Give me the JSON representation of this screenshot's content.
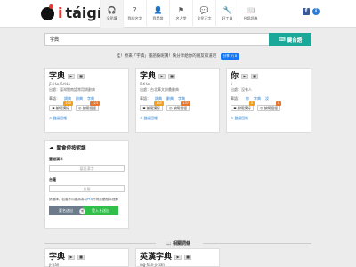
{
  "header": {
    "logo_i": "i",
    "logo_text": "táigí",
    "nav": [
      {
        "icon": "headphones-icon",
        "glyph": "🎧",
        "label": "全民講",
        "active": true
      },
      {
        "icon": "question-icon",
        "glyph": "?",
        "label": "我的名字",
        "active": false
      },
      {
        "icon": "user-icon",
        "glyph": "👤",
        "label": "我是誰",
        "active": false
      },
      {
        "icon": "flag-icon",
        "glyph": "⚑",
        "label": "名人堂",
        "active": false
      },
      {
        "icon": "chat-icon",
        "glyph": "💬",
        "label": "全民正字",
        "active": false
      },
      {
        "icon": "wrench-icon",
        "glyph": "🔧",
        "label": "好工具",
        "active": false
      },
      {
        "icon": "book-icon",
        "glyph": "📖",
        "label": "台語詞典",
        "active": false
      }
    ],
    "facebook_label": "f",
    "info_label": "i"
  },
  "search": {
    "value": "字典",
    "button_label": "鍵台語",
    "button_icon": "keyboard-icon"
  },
  "promo": {
    "text": "哇！原來「字典」臺語按呢講！快分享給你的朋友知道吧",
    "share_label": "分享 (f) 8"
  },
  "cards": [
    {
      "hanji": "字典",
      "roman": "jī-tián/lī-tián",
      "source": "出處：臺灣閩南語常用詞辭典",
      "dialect_label": "華語：",
      "dialects": [
        "詞典",
        "辭典",
        "字典"
      ],
      "vote_good": "按呢講好",
      "vote_bad": "按呢怪怪",
      "good_count": "100",
      "bad_count": "123",
      "report": "錯誤回報"
    },
    {
      "hanji": "字典",
      "roman": "lī-tián",
      "source": "出處：台北華文辭彙辭典",
      "dialect_label": "華語：",
      "dialects": [
        "詞典",
        "辭典",
        "字典"
      ],
      "vote_good": "按呢講好",
      "vote_bad": "按呢怪怪",
      "good_count": "140",
      "bad_count": "137",
      "report": "錯誤回報"
    },
    {
      "hanji": "你",
      "roman": "lí",
      "source": "出處：沒有人",
      "dialect_label": "華語：",
      "dialects": [
        "你",
        "字典",
        "汝"
      ],
      "vote_good": "按呢講好",
      "vote_bad": "按呢怪怪",
      "good_count": "0",
      "bad_count": "0",
      "report": "錯誤回報"
    }
  ],
  "recorder": {
    "title": "閣會使按呢講",
    "label1": "臺語漢字",
    "placeholder1": "臺語漢字",
    "label2": "台羅",
    "placeholder2": "台羅",
    "note_prefix": "請選擇，若要不同要將為以",
    "note_link": "POJ",
    "note_suffix": "不得延續相似理解",
    "login_label": "要名送出",
    "or_label": "或",
    "signup_label": "登入＆送出"
  },
  "related": {
    "title": "相關詞條",
    "cards": [
      {
        "hanji": "字典",
        "roman": "jī-tián"
      },
      {
        "hanji": "英漢字典",
        "roman": "ing-hàn-jī-tián"
      }
    ]
  }
}
